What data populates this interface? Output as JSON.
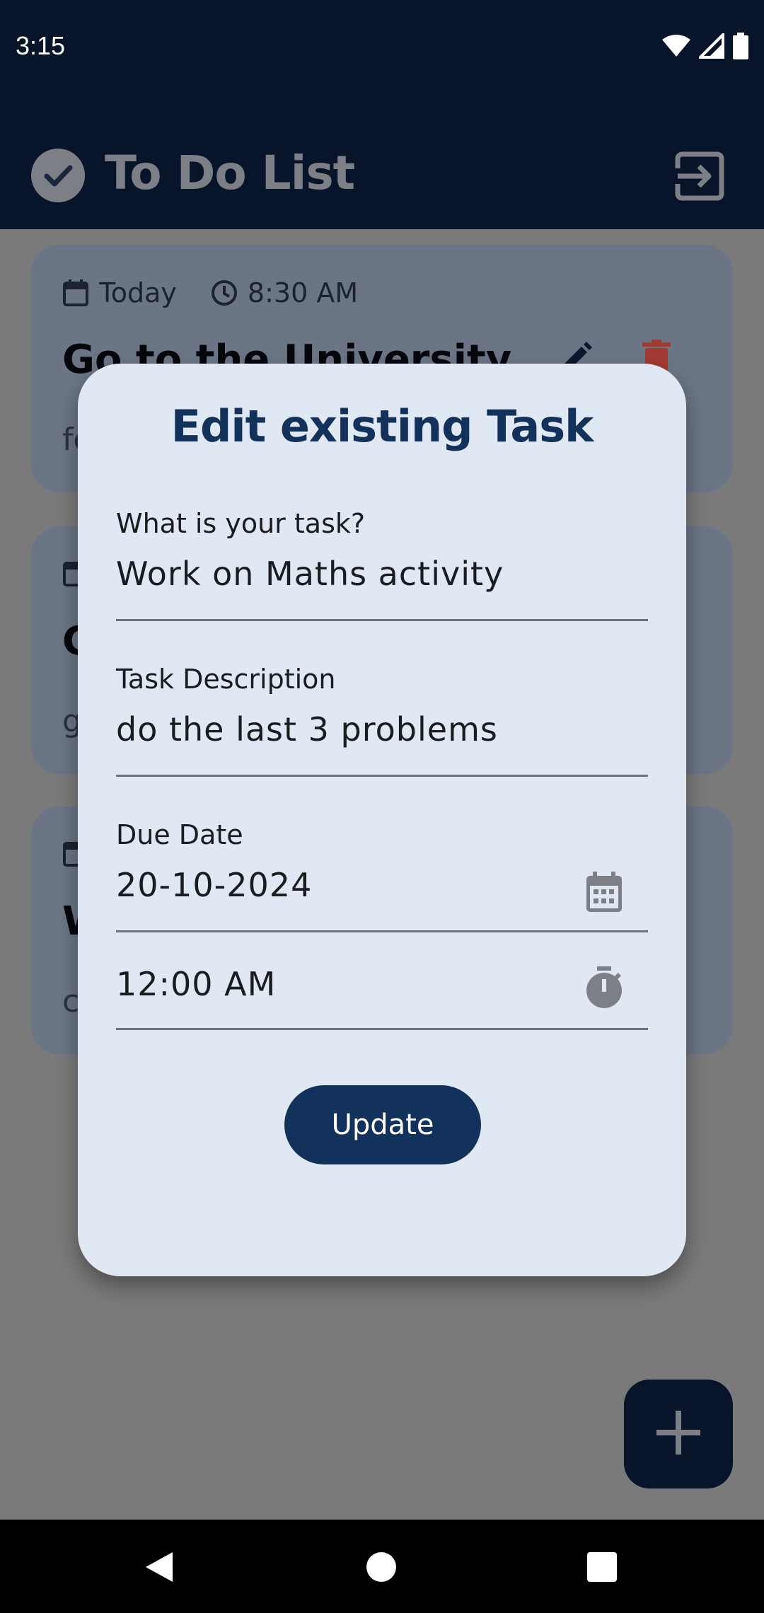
{
  "status_bar": {
    "time": "3:15",
    "icons": [
      "wifi-icon",
      "signal-icon",
      "battery-icon"
    ]
  },
  "app_bar": {
    "title": "To Do List",
    "leading_icon": "check-circle-icon",
    "action_icon": "logout-icon"
  },
  "tasks": [
    {
      "date": "Today",
      "time": "8:30 AM",
      "title": "Go to the University",
      "description": "fo"
    },
    {
      "date": "",
      "time": "",
      "title": "G",
      "description": "g"
    },
    {
      "date": "",
      "time": "",
      "title": "W",
      "description": "c"
    }
  ],
  "dialog": {
    "title": "Edit existing Task",
    "task_label": "What is your task?",
    "task_value": "Work on Maths activity",
    "description_label": "Task Description",
    "description_value": "do the last 3 problems",
    "due_label": "Due Date",
    "due_date": "20-10-2024",
    "due_time": "12:00 AM",
    "update_label": "Update"
  },
  "colors": {
    "app_bar": "#08142a",
    "dialog_bg": "#dfe8f3",
    "primary": "#13325b",
    "scrim": "#7a7a7a",
    "delete": "#b3342e"
  }
}
